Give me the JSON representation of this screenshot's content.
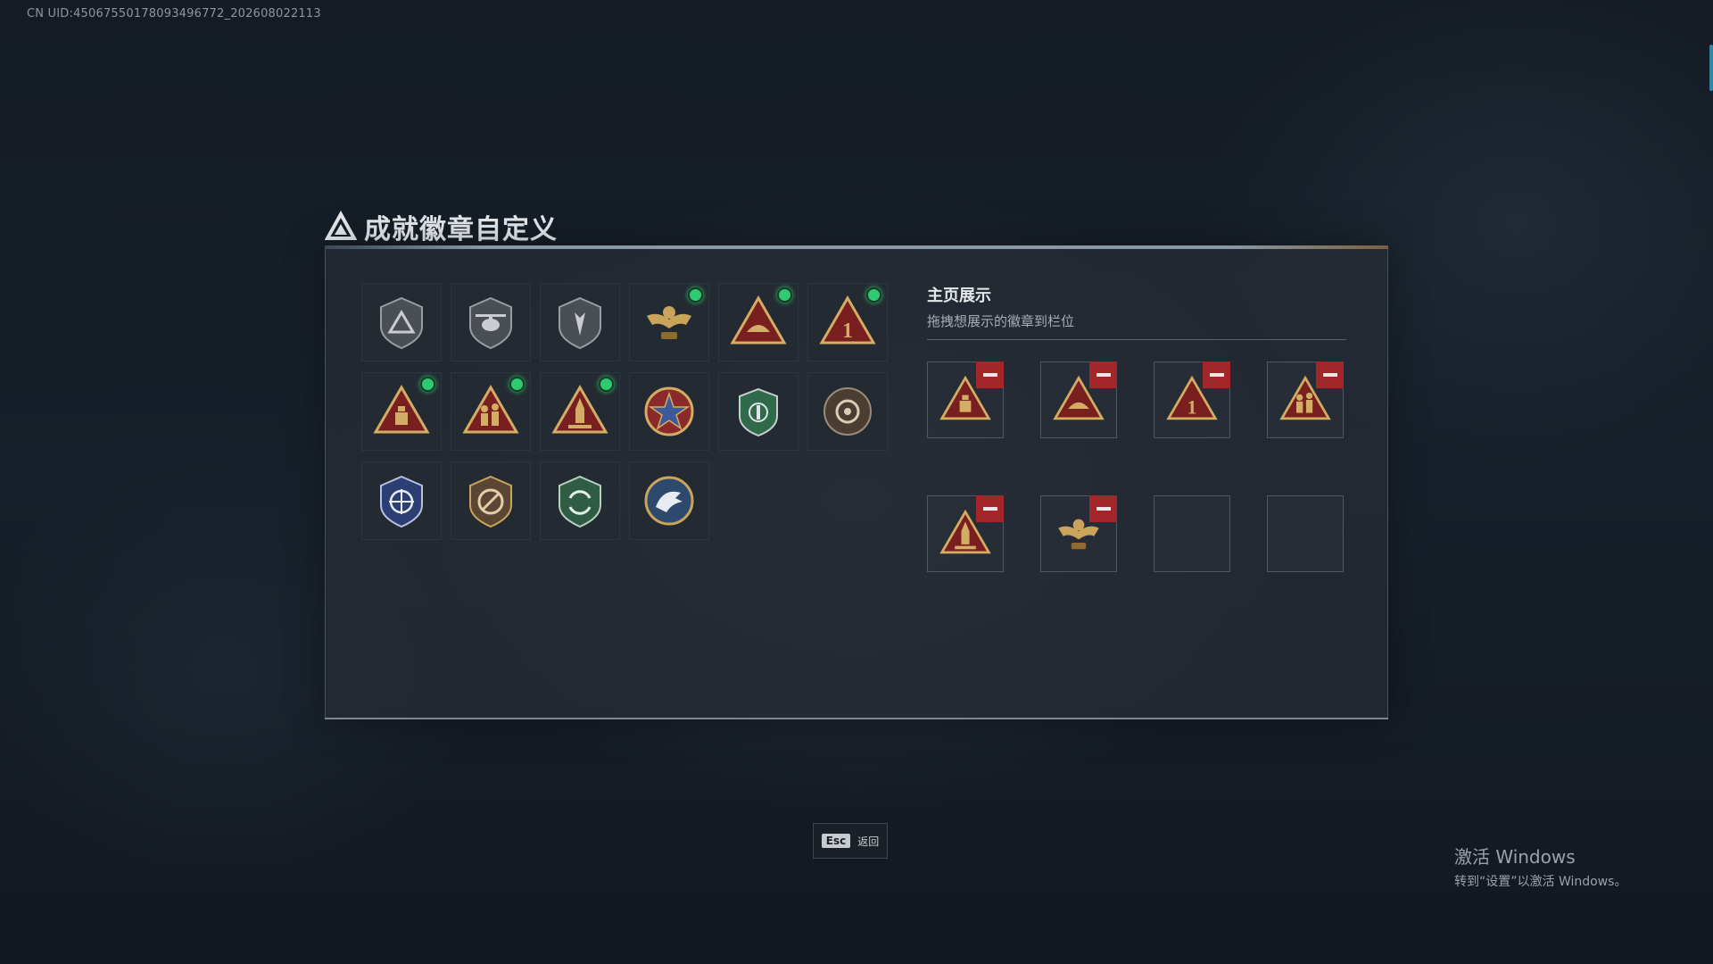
{
  "uid_text": "CN UID:4506755017809349677​2_202608022113",
  "header": {
    "title": "成就徽章自定义",
    "icon": "triangle-logo-icon"
  },
  "badges": [
    {
      "icon": "triangle-shield-icon",
      "new": false
    },
    {
      "icon": "helicopter-shield-icon",
      "new": false
    },
    {
      "icon": "spear-shield-icon",
      "new": false
    },
    {
      "icon": "winged-eagle-icon",
      "new": true
    },
    {
      "icon": "hand-triangle-icon",
      "new": true
    },
    {
      "icon": "number-one-triangle-icon",
      "new": true
    },
    {
      "icon": "crate-triangle-icon",
      "new": true
    },
    {
      "icon": "soldiers-triangle-icon",
      "new": true
    },
    {
      "icon": "rocket-triangle-icon",
      "new": true
    },
    {
      "icon": "star-medal-icon",
      "new": false
    },
    {
      "icon": "green-shield-icon",
      "new": false
    },
    {
      "icon": "round-emblem-icon",
      "new": false
    },
    {
      "icon": "blue-crosshair-shield-icon",
      "new": false
    },
    {
      "icon": "no-gun-shield-icon",
      "new": false
    },
    {
      "icon": "green-arrows-shield-icon",
      "new": false
    },
    {
      "icon": "eagle-head-icon",
      "new": false
    }
  ],
  "showcase": {
    "title": "主页展示",
    "subtitle": "拖拽想展示的徽章到栏位",
    "slots": [
      {
        "icon": "crate-triangle-icon"
      },
      {
        "icon": "hand-triangle-icon"
      },
      {
        "icon": "number-one-triangle-icon"
      },
      {
        "icon": "soldiers-triangle-icon"
      },
      {
        "icon": "rocket-triangle-icon"
      },
      {
        "icon": "winged-eagle-icon"
      },
      {
        "icon": ""
      },
      {
        "icon": ""
      }
    ]
  },
  "footer": {
    "esc_key": "Esc",
    "esc_label": "返回"
  },
  "activation": {
    "title": "激活 Windows",
    "subtitle": "转到“设置”以激活 Windows。"
  }
}
